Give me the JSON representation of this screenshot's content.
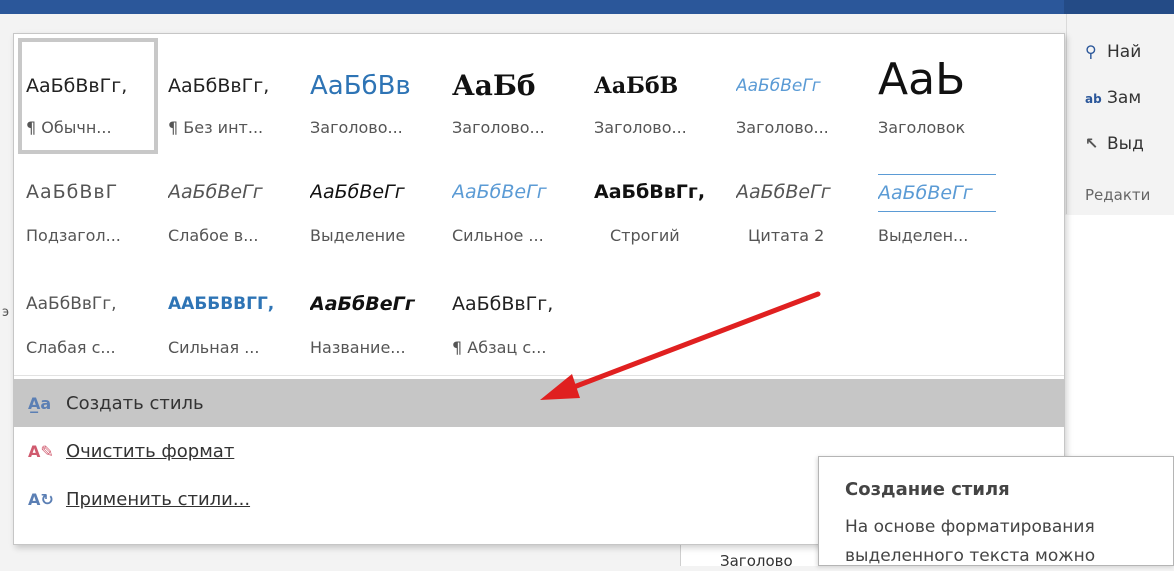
{
  "ribbon": {
    "find_label": "Най",
    "replace_label": "Зам",
    "select_label": "Выд",
    "group_label": "Редакти",
    "left_mark": "э"
  },
  "document": {
    "heading_text": "Заголово"
  },
  "gallery": {
    "row1": [
      {
        "sample": "АаБбВвГг,",
        "name": "¶ Обычн...",
        "style": "normal"
      },
      {
        "sample": "АаБбВвГг,",
        "name": "¶ Без инт...",
        "style": "nospacing"
      },
      {
        "sample": "АаБбВв",
        "name": "Заголово...",
        "style": "h1"
      },
      {
        "sample": "АаБб",
        "name": "Заголово...",
        "style": "h2"
      },
      {
        "sample": "АаБбВ",
        "name": "Заголово...",
        "style": "h3"
      },
      {
        "sample": "АаБбВеГг",
        "name": "Заголово...",
        "style": "h4"
      },
      {
        "sample": "АаЬ",
        "name": "Заголовок",
        "style": "title"
      }
    ],
    "row2": [
      {
        "sample": "АаБбВвГ",
        "name": "Подзагол...",
        "style": "subtitle"
      },
      {
        "sample": "АаБбВеГг",
        "name": "Слабое в...",
        "style": "subtle_em"
      },
      {
        "sample": "АаБбВеГг",
        "name": "Выделение",
        "style": "emphasis"
      },
      {
        "sample": "АаБбВеГг",
        "name": "Сильное ...",
        "style": "intense_em"
      },
      {
        "sample": "АаБбВвГг,",
        "name": "Строгий",
        "style": "strong"
      },
      {
        "sample": "АаБбВеГг",
        "name": "Цитата 2",
        "style": "quote"
      },
      {
        "sample": "АаБбВеГг",
        "name": "Выделен...",
        "style": "intense_quote"
      }
    ],
    "row3": [
      {
        "sample": "АаБбВвГг,",
        "name": "Слабая с...",
        "style": "subtle_ref"
      },
      {
        "sample": "ААББВВГГ,",
        "name": "Сильная ...",
        "style": "intense_ref"
      },
      {
        "sample": "АаБбВеГг",
        "name": "Название...",
        "style": "book_title"
      },
      {
        "sample": "АаБбВвГг,",
        "name": "¶ Абзац с...",
        "style": "list_para"
      }
    ]
  },
  "menu": {
    "create_style": "Создать стиль",
    "clear_format": "Очистить формат",
    "apply_styles": "Применить стили..."
  },
  "tooltip": {
    "title": "Создание стиля",
    "body": "На основе форматирования выделенного текста можно"
  },
  "colors": {
    "accent": "#2b579a",
    "heading_blue": "#2e74b5",
    "light_blue": "#5b9bd5",
    "arrow_red": "#e02020",
    "highlight": "#c6c6c6"
  }
}
